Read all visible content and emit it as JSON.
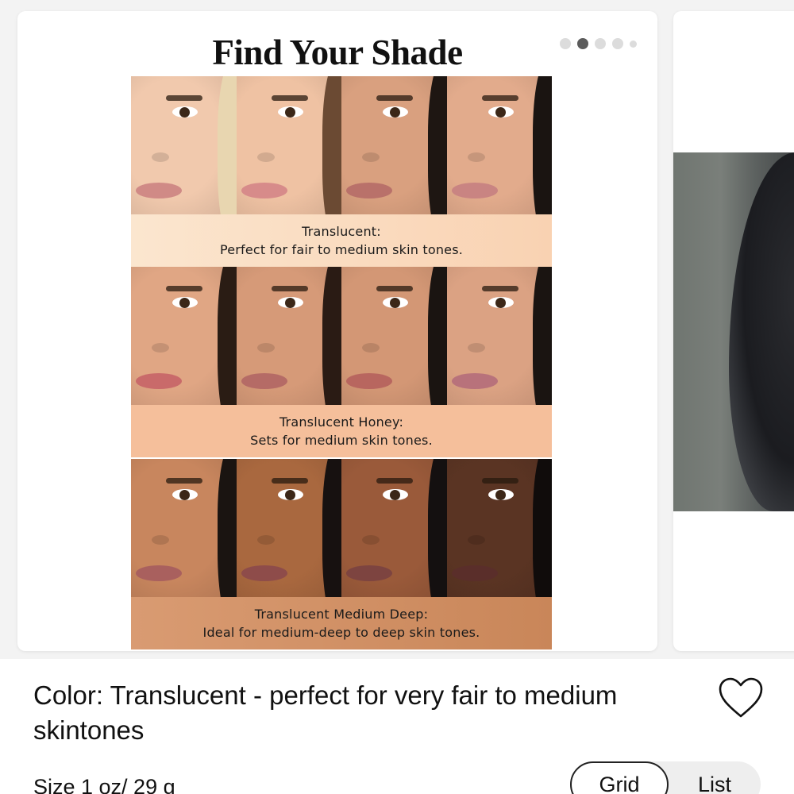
{
  "carousel": {
    "card": {
      "title": "Find Your Shade",
      "dots": [
        {
          "state": "inactive"
        },
        {
          "state": "active"
        },
        {
          "state": "inactive"
        },
        {
          "state": "inactive"
        },
        {
          "state": "inactive-small"
        }
      ],
      "shades": [
        {
          "name": "Translucent:",
          "description": "Perfect for fair to medium skin tones.",
          "faces": [
            {
              "skin": "#f1c9ad",
              "hair": "#e8d6b0",
              "lips": "#d08a86"
            },
            {
              "skin": "#efc2a3",
              "hair": "#6b4a33",
              "lips": "#d78b8a"
            },
            {
              "skin": "#d9a07f",
              "hair": "#1e1612",
              "lips": "#b9716a"
            },
            {
              "skin": "#e2ab8c",
              "hair": "#1a1411",
              "lips": "#c98482"
            }
          ]
        },
        {
          "name": "Translucent Honey:",
          "description": "Sets for medium skin tones.",
          "faces": [
            {
              "skin": "#e0a684",
              "hair": "#2a1c14",
              "lips": "#c96a6a"
            },
            {
              "skin": "#d69a78",
              "hair": "#2a1b14",
              "lips": "#b56b66"
            },
            {
              "skin": "#d39775",
              "hair": "#1a1411",
              "lips": "#b8665f"
            },
            {
              "skin": "#dba283",
              "hair": "#1a1411",
              "lips": "#b8727b"
            }
          ]
        },
        {
          "name": "Translucent Medium Deep:",
          "description": "Ideal for medium-deep to deep skin tones.",
          "faces": [
            {
              "skin": "#c8865e",
              "hair": "#1a1411",
              "lips": "#a9605e"
            },
            {
              "skin": "#a9683f",
              "hair": "#171110",
              "lips": "#8e4c4a"
            },
            {
              "skin": "#9a5a3a",
              "hair": "#141010",
              "lips": "#7d4440"
            },
            {
              "skin": "#5a3423",
              "hair": "#100c0b",
              "lips": "#5a2e2a"
            }
          ]
        }
      ]
    }
  },
  "product": {
    "color_text": "Color: Translucent - perfect for very fair to medium skintones",
    "wishlist_icon": "heart-outline-icon",
    "size_text": "Size 1 oz/ 29 g",
    "view_toggle": {
      "grid_label": "Grid",
      "list_label": "List",
      "selected": "Grid"
    }
  }
}
